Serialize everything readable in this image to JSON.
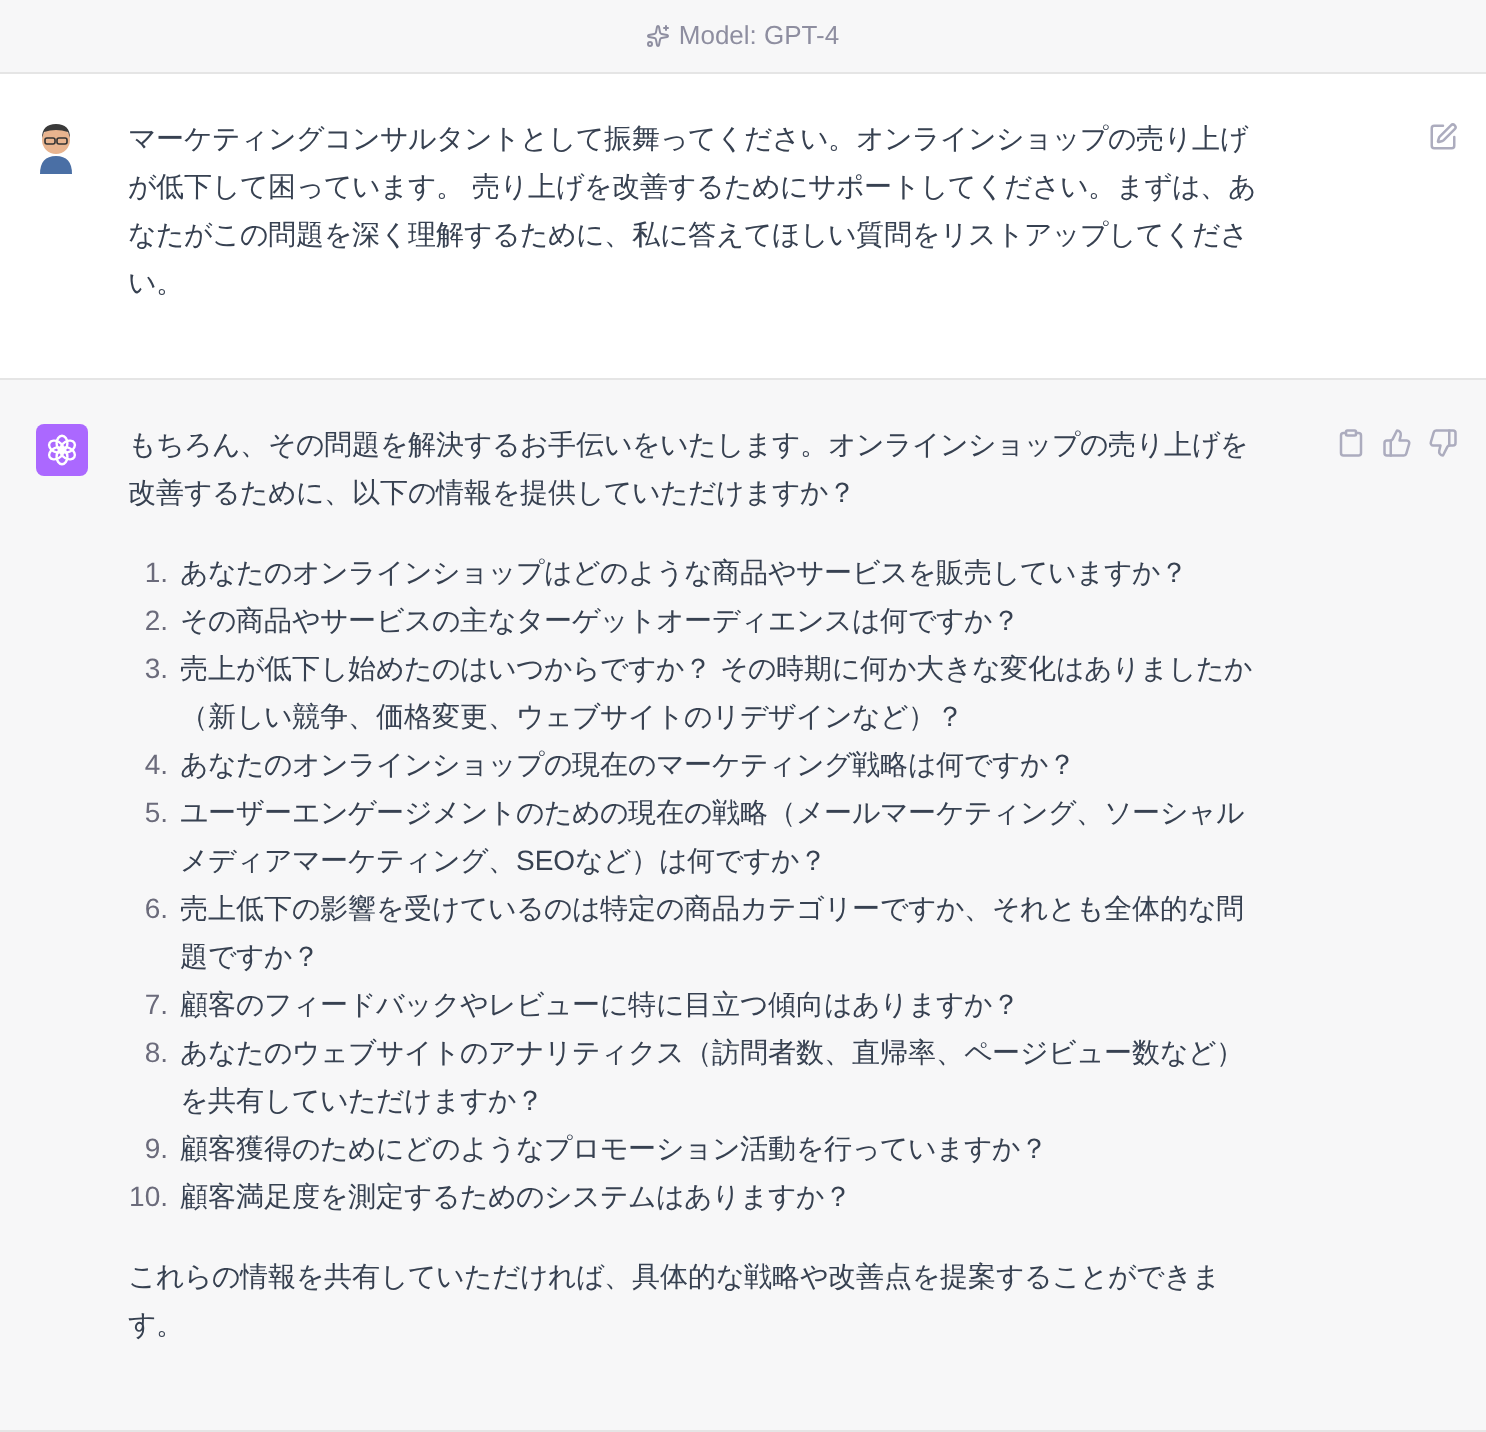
{
  "header": {
    "model_label": "Model: GPT-4"
  },
  "messages": [
    {
      "kind": "user",
      "paragraphs": [
        "マーケティングコンサルタントとして振舞ってください。オンラインショップの売り上げが低下して困っています。 売り上げを改善するためにサポートしてください。まずは、あなたがこの問題を深く理解するために、私に答えてほしい質問をリストアップしてください。"
      ]
    },
    {
      "kind": "assistant",
      "paragraphs": [
        "もちろん、その問題を解決するお手伝いをいたします。オンラインショップの売り上げを改善するために、以下の情報を提供していただけますか？"
      ],
      "list": [
        {
          "number": "1.",
          "text": "あなたのオンラインショップはどのような商品やサービスを販売していますか？"
        },
        {
          "number": "2.",
          "text": "その商品やサービスの主なターゲットオーディエンスは何ですか？"
        },
        {
          "number": "3.",
          "text": "売上が低下し始めたのはいつからですか？ その時期に何か大きな変化はありましたか（新しい競争、価格変更、ウェブサイトのリデザインなど）？"
        },
        {
          "number": "4.",
          "text": "あなたのオンラインショップの現在のマーケティング戦略は何ですか？"
        },
        {
          "number": "5.",
          "text": "ユーザーエンゲージメントのための現在の戦略（メールマーケティング、ソーシャルメディアマーケティング、SEOなど）は何ですか？"
        },
        {
          "number": "6.",
          "text": "売上低下の影響を受けているのは特定の商品カテゴリーですか、それとも全体的な問題ですか？"
        },
        {
          "number": "7.",
          "text": "顧客のフィードバックやレビューに特に目立つ傾向はありますか？"
        },
        {
          "number": "8.",
          "text": "あなたのウェブサイトのアナリティクス（訪問者数、直帰率、ページビュー数など）を共有していただけますか？"
        },
        {
          "number": "9.",
          "text": "顧客獲得のためにどのようなプロモーション活動を行っていますか？"
        },
        {
          "number": "10.",
          "text": "顧客満足度を測定するためのシステムはありますか？"
        }
      ],
      "closing": "これらの情報を共有していただければ、具体的な戦略や改善点を提案することができます。"
    }
  ]
}
